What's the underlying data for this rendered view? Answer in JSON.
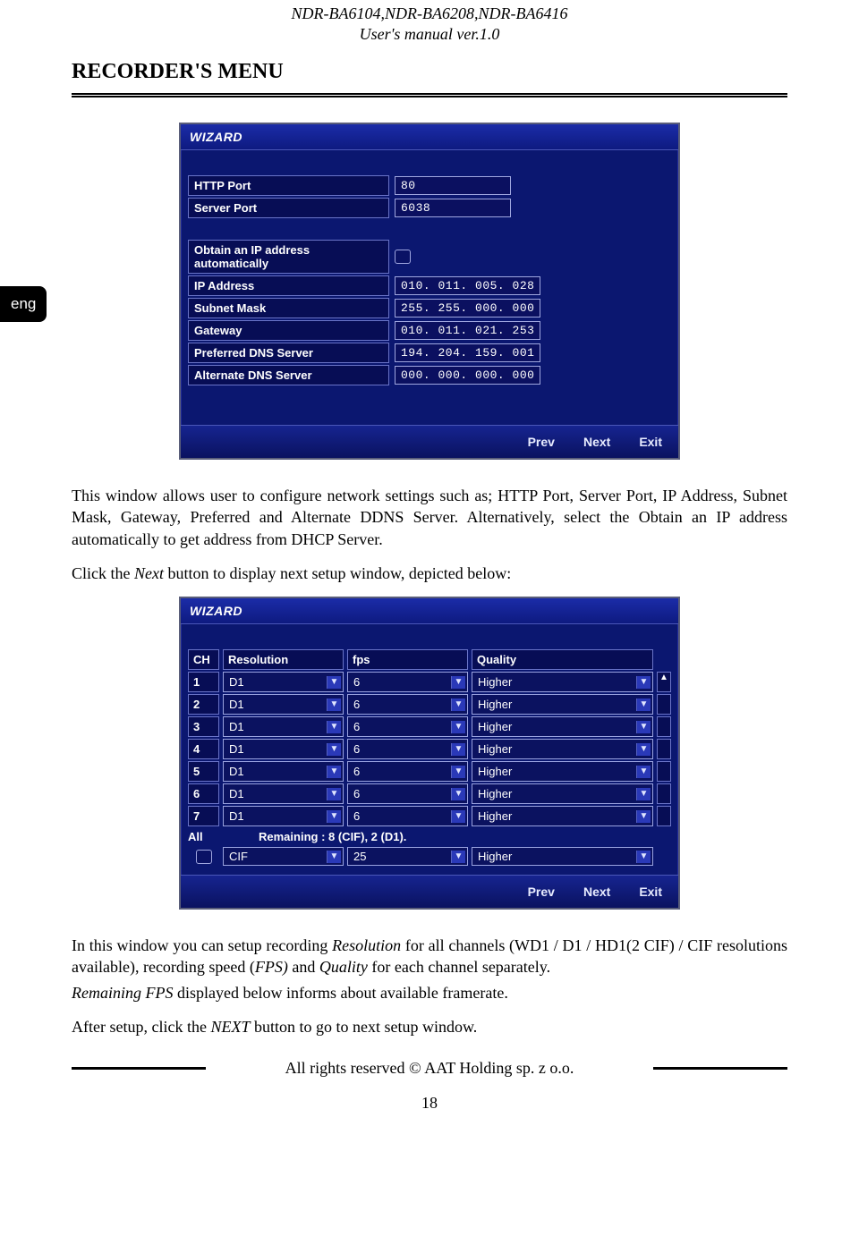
{
  "header": {
    "models": "NDR-BA6104,NDR-BA6208,NDR-BA6416",
    "subtitle": "User's manual ver.1.0"
  },
  "section_title": "RECORDER'S MENU",
  "lang_tab": "eng",
  "wizard1": {
    "title": "WIZARD",
    "rows": [
      {
        "label": "HTTP Port",
        "value": "80",
        "type": "text"
      },
      {
        "label": "Server Port",
        "value": "6038",
        "type": "text"
      }
    ],
    "rows2": [
      {
        "label": "Obtain an IP address automatically",
        "type": "check"
      },
      {
        "label": "IP Address",
        "value": "010. 011. 005. 028",
        "type": "text"
      },
      {
        "label": "Subnet Mask",
        "value": "255. 255. 000. 000",
        "type": "text"
      },
      {
        "label": "Gateway",
        "value": "010. 011. 021. 253",
        "type": "text"
      },
      {
        "label": "Preferred DNS Server",
        "value": "194. 204. 159. 001",
        "type": "text"
      },
      {
        "label": "Alternate DNS Server",
        "value": "000. 000. 000. 000",
        "type": "text"
      }
    ],
    "buttons": {
      "prev": "Prev",
      "next": "Next",
      "exit": "Exit"
    }
  },
  "para1": "This window allows user to configure network settings such as; HTTP Port, Server Port, IP Address, Subnet Mask, Gateway, Preferred and Alternate DDNS Server. Alternatively, select the Obtain an IP address automatically to get address from DHCP Server.",
  "para2_pre": "Click the ",
  "para2_em": "Next",
  "para2_post": " button to display next setup window, depicted below:",
  "wizard2": {
    "title": "WIZARD",
    "head": {
      "ch": "CH",
      "res": "Resolution",
      "fps": "fps",
      "q": "Quality"
    },
    "rows": [
      {
        "ch": "1",
        "res": "D1",
        "fps": "6",
        "q": "Higher"
      },
      {
        "ch": "2",
        "res": "D1",
        "fps": "6",
        "q": "Higher"
      },
      {
        "ch": "3",
        "res": "D1",
        "fps": "6",
        "q": "Higher"
      },
      {
        "ch": "4",
        "res": "D1",
        "fps": "6",
        "q": "Higher"
      },
      {
        "ch": "5",
        "res": "D1",
        "fps": "6",
        "q": "Higher"
      },
      {
        "ch": "6",
        "res": "D1",
        "fps": "6",
        "q": "Higher"
      },
      {
        "ch": "7",
        "res": "D1",
        "fps": "6",
        "q": "Higher"
      }
    ],
    "all_label": "All",
    "remaining": "Remaining : 8 (CIF), 2 (D1).",
    "allrow": {
      "res": "CIF",
      "fps": "25",
      "q": "Higher"
    },
    "buttons": {
      "prev": "Prev",
      "next": "Next",
      "exit": "Exit"
    }
  },
  "para3_1": "In this window you can setup recording ",
  "para3_em1": "Resolution",
  "para3_2": " for all channels (WD1 / D1 / HD1(2 CIF) / CIF resolutions available), recording speed (",
  "para3_em2": "FPS)",
  "para3_3": " and ",
  "para3_em3": "Quality",
  "para3_4": " for each channel separately.",
  "para4_em": "Remaining FPS",
  "para4_post": " displayed below informs about available framerate.",
  "para5_pre": "After setup, click the ",
  "para5_em": "NEXT",
  "para5_post": " button to go to next setup window.",
  "footer_text": "All rights reserved © AAT Holding sp. z o.o.",
  "page_num": "18"
}
